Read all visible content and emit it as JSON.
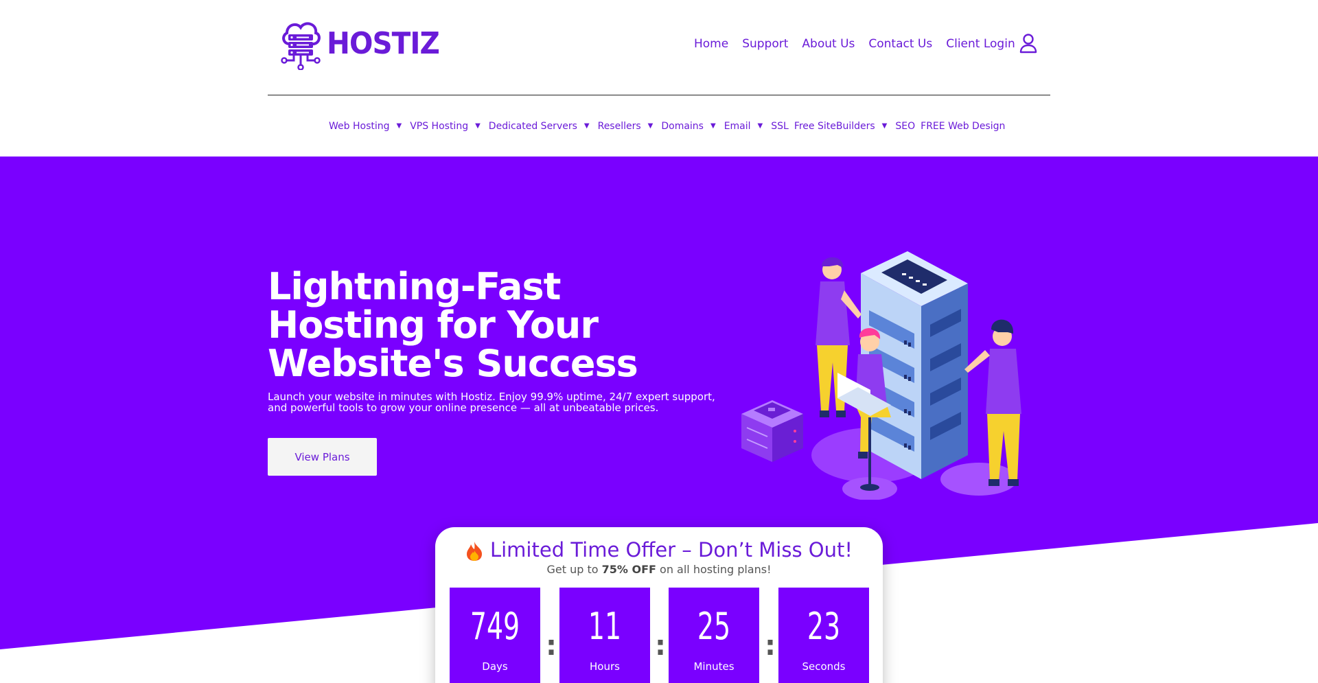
{
  "brand": {
    "name": "HOSTIZ",
    "accent": "#7a00ff",
    "text_purple": "#6a1bd8"
  },
  "topnav": [
    {
      "label": "Home"
    },
    {
      "label": "Support"
    },
    {
      "label": "About Us"
    },
    {
      "label": "Contact Us"
    },
    {
      "label": "Client Login"
    }
  ],
  "user_icon": "user-icon",
  "subnav": [
    {
      "label": "Web Hosting",
      "dropdown": true
    },
    {
      "label": "VPS Hosting",
      "dropdown": true
    },
    {
      "label": "Dedicated Servers",
      "dropdown": true
    },
    {
      "label": "Resellers",
      "dropdown": true
    },
    {
      "label": "Domains",
      "dropdown": true
    },
    {
      "label": "Email",
      "dropdown": true
    },
    {
      "label": "SSL",
      "dropdown": false
    },
    {
      "label": "Free SiteBuilders",
      "dropdown": true
    },
    {
      "label": "SEO",
      "dropdown": false
    },
    {
      "label": "FREE Web Design",
      "dropdown": false
    }
  ],
  "hero": {
    "title": "Lightning-Fast Hosting for Your Website's Success",
    "description": "Launch your website in minutes with Hostiz. Enjoy 99.9% uptime, 24/7 expert support, and powerful tools to grow your online presence — all at unbeatable prices.",
    "cta_label": "View Plans"
  },
  "offer": {
    "title": "Limited Time Offer – Don’t Miss Out!",
    "subtitle_prefix": "Get up to ",
    "subtitle_bold": "75% OFF",
    "subtitle_suffix": " on all hosting plans!",
    "countdown": [
      {
        "value": "749",
        "label": "Days"
      },
      {
        "value": "11",
        "label": "Hours"
      },
      {
        "value": "25",
        "label": "Minutes"
      },
      {
        "value": "23",
        "label": "Seconds"
      }
    ]
  }
}
